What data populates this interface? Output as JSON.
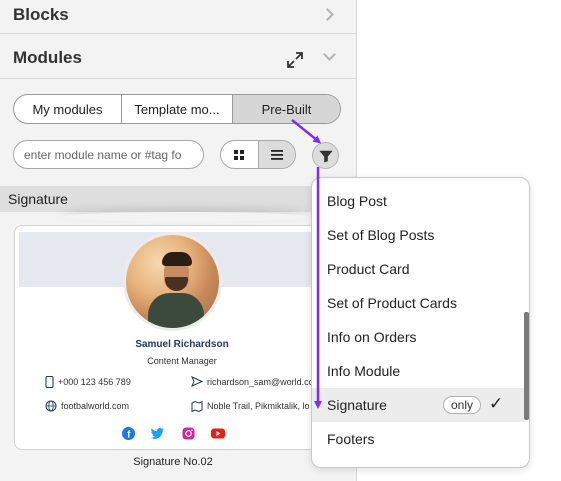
{
  "panel": {
    "blocks_label": "Blocks",
    "modules_label": "Modules"
  },
  "tabs": [
    {
      "label": "My modules",
      "active": false
    },
    {
      "label": "Template mo...",
      "active": false
    },
    {
      "label": "Pre-Built",
      "active": true
    }
  ],
  "search": {
    "placeholder": "enter module name or #tag fo",
    "value": ""
  },
  "view_toggle": {
    "options": [
      "grid-icon",
      "list-icon"
    ],
    "active": "list-icon"
  },
  "filter": {
    "icon": "filter-icon"
  },
  "category": {
    "label": "Signature"
  },
  "card": {
    "name": "Samuel Richardson",
    "title": "Content Manager",
    "phone": "+000 123 456 789",
    "email": "richardson_sam@world.co",
    "website": "footbalworld.com",
    "address": "Noble Trail, Pikmiktalik, lo",
    "social": [
      "facebook-icon",
      "twitter-icon",
      "instagram-icon",
      "youtube-icon"
    ],
    "caption": "Signature No.02",
    "colors": {
      "name": "#1e3a66",
      "facebook": "#1877f2",
      "twitter": "#1da1f2",
      "instagram": "#d6249f",
      "youtube": "#e62117"
    }
  },
  "dropdown": {
    "items": [
      {
        "label": "Blog Post"
      },
      {
        "label": "Set of Blog Posts"
      },
      {
        "label": "Product Card"
      },
      {
        "label": "Set of Product Cards"
      },
      {
        "label": "Info on Orders"
      },
      {
        "label": "Info Module"
      },
      {
        "label": "Signature",
        "selected": true,
        "badge": "only",
        "check": "✓"
      },
      {
        "label": "Footers"
      }
    ]
  },
  "colors": {
    "annotation_arrow": "#7b2ff7"
  }
}
